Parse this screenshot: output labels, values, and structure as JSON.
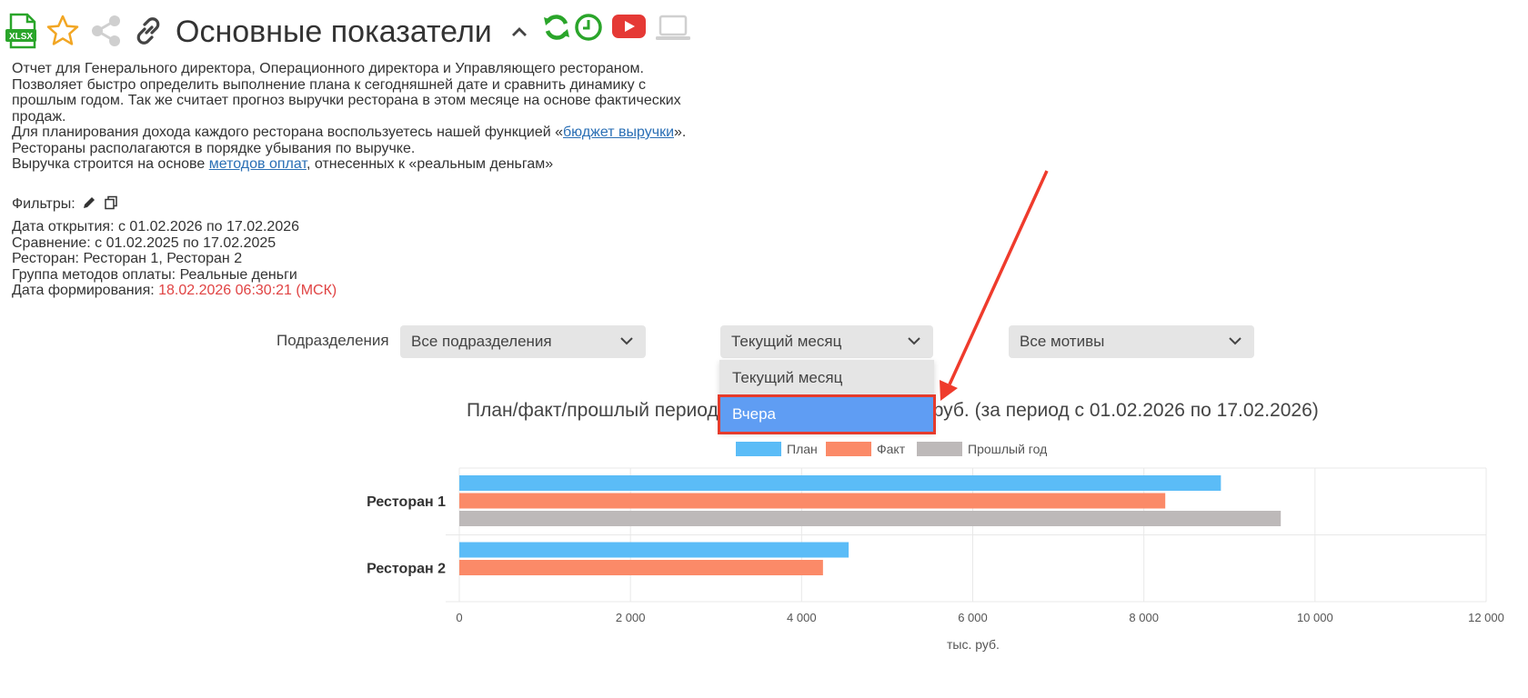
{
  "header": {
    "title": "Основные показатели",
    "xlsx_label": "XLSX",
    "icons": [
      "xlsx-export-icon",
      "star-icon",
      "share-icon",
      "link-icon",
      "collapse-chevron-icon",
      "refresh-icon",
      "clock-icon",
      "youtube-icon",
      "laptop-icon"
    ],
    "colors": {
      "green": "#2aa52a",
      "youtube": "#e53935",
      "star": "#f2a623",
      "grey": "#c8c8c8"
    }
  },
  "description": {
    "line1": "Отчет для Генерального директора, Операционного директора и Управляющего рестораном.",
    "line2": "Позволяет быстро определить выполнение плана к сегодняшней дате и сравнить динамику с",
    "line3": "прошлым годом. Так же считает прогноз выручки ресторана в этом месяце на основе фактических",
    "line4": "продаж.",
    "line5_pre": "Для планирования дохода каждого ресторана воспользуетесь нашей функцией «",
    "line5_link": "бюджет выручки",
    "line5_post": "».",
    "line6": "Рестораны располагаются в порядке убывания по выручке.",
    "line7_pre": "Выручка строится на основе ",
    "line7_link": "методов оплат",
    "line7_post": ", отнесенных к «реальным деньгам»"
  },
  "filters": {
    "title": "Фильтры:",
    "open_date": "Дата открытия: с 01.02.2026 по 17.02.2026",
    "comparison": "Сравнение: с 01.02.2025 по 17.02.2025",
    "restaurant": "Ресторан: Ресторан 1, Ресторан 2",
    "payment_group": "Группа методов оплаты: Реальные деньги",
    "generated_label": "Дата формирования: ",
    "generated_value": "18.02.2026 06:30:21 (МСК)"
  },
  "controls": {
    "departments_label": "Подразделения",
    "departments_value": "Все подразделения",
    "period_value": "Текущий месяц",
    "motives_value": "Все мотивы",
    "period_options": [
      "Текущий месяц",
      "Вчера"
    ],
    "highlighted_option": "Вчера"
  },
  "chart_data": {
    "type": "bar",
    "orientation": "horizontal",
    "title_left": "План/факт/прошлый период",
    "title_right": "руб. (за период с 01.02.2026 по 17.02.2026)",
    "categories": [
      "Ресторан 1",
      "Ресторан 2"
    ],
    "series": [
      {
        "name": "План",
        "color": "#5bbcf7",
        "values": [
          8900,
          4550
        ]
      },
      {
        "name": "Факт",
        "color": "#fb8a68",
        "values": [
          8250,
          4250
        ]
      },
      {
        "name": "Прошлый год",
        "color": "#bdb9b9",
        "values": [
          9600,
          null
        ]
      }
    ],
    "xlabel": "тыс. руб.",
    "xlim": [
      0,
      12000
    ],
    "xticks": [
      0,
      2000,
      4000,
      6000,
      8000,
      10000,
      12000
    ],
    "xtick_labels": [
      "0",
      "2 000",
      "4 000",
      "6 000",
      "8 000",
      "10 000",
      "12 000"
    ],
    "grid": true,
    "legend_position": "top"
  }
}
